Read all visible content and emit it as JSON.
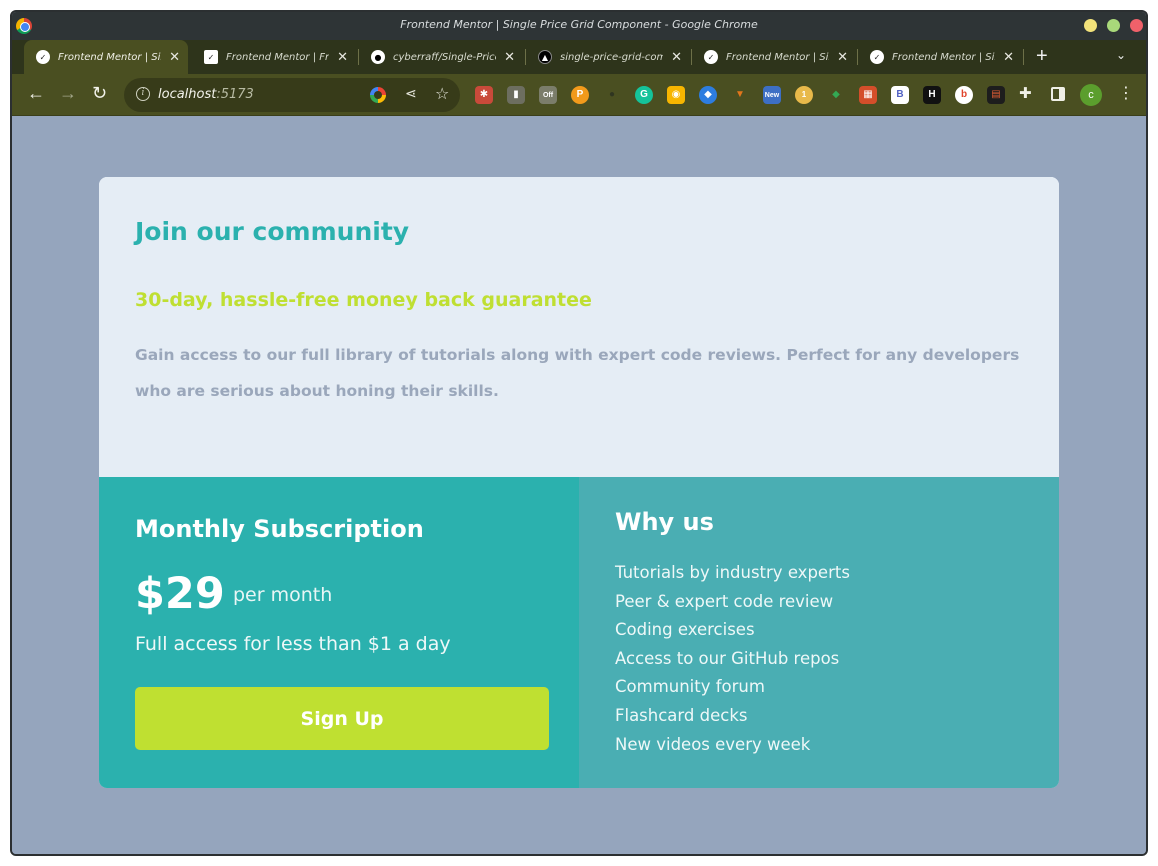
{
  "window": {
    "title": "Frontend Mentor | Single Price Grid Component - Google Chrome"
  },
  "tabs": [
    {
      "label": "Frontend Mentor | Single Price Grid",
      "icon": "frontend-mentor-icon",
      "active": true
    },
    {
      "label": "Frontend Mentor | Frontend",
      "icon": "frontend-mentor-icon",
      "active": false
    },
    {
      "label": "cyberraff/Single-Price-Grid",
      "icon": "github-icon",
      "active": false
    },
    {
      "label": "single-price-grid-component",
      "icon": "vercel-icon",
      "active": false
    },
    {
      "label": "Frontend Mentor | Single",
      "icon": "frontend-mentor-icon",
      "active": false
    },
    {
      "label": "Frontend Mentor | Single",
      "icon": "frontend-mentor-icon",
      "active": false
    }
  ],
  "toolbar": {
    "url_host": "localhost",
    "url_port": ":5173",
    "profile_initial": "c",
    "extension_badges": [
      "Off",
      "New",
      "1"
    ]
  },
  "card": {
    "heading": "Join our community",
    "subheading": "30-day, hassle-free money back guarantee",
    "description": "Gain access to our full library of tutorials along with expert code reviews. Perfect for any developers who are serious about honing their skills.",
    "subscription": {
      "title": "Monthly Subscription",
      "price": "$29",
      "period": "per month",
      "tagline": "Full access for less than $1 a day",
      "cta": "Sign Up"
    },
    "why_us": {
      "title": "Why us",
      "items": [
        "Tutorials by industry experts",
        "Peer & expert code review",
        "Coding exercises",
        "Access to our GitHub repos",
        "Community forum",
        "Flashcard decks",
        "New videos every week"
      ]
    }
  },
  "colors": {
    "background": "#95a5bd",
    "cyan": "#2bb1ae",
    "light_cyan": "#4aaeb3",
    "yellow": "#bfdf32",
    "gray_text": "#9aa7bb"
  }
}
